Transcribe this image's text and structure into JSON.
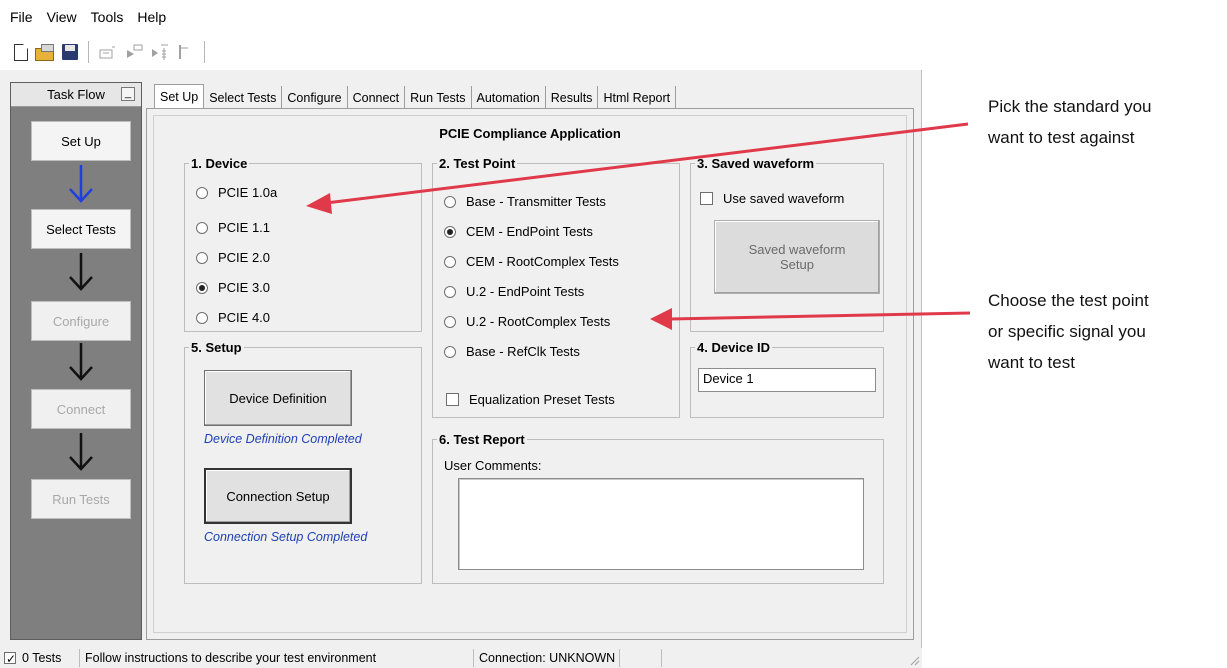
{
  "menu": [
    "File",
    "View",
    "Tools",
    "Help"
  ],
  "toolbar": {
    "icons": [
      "new-file-icon",
      "open-folder-icon",
      "save-icon",
      "run-icon",
      "step-icon",
      "sequence-icon",
      "stop-icon"
    ]
  },
  "taskflow": {
    "title": "Task Flow",
    "minimize": "_",
    "steps": [
      {
        "label": "Set Up",
        "enabled": true
      },
      {
        "label": "Select Tests",
        "enabled": true
      },
      {
        "label": "Configure",
        "enabled": false
      },
      {
        "label": "Connect",
        "enabled": false
      },
      {
        "label": "Run Tests",
        "enabled": false
      }
    ],
    "arrow_colors": [
      "#1f3fe0",
      "#111111",
      "#111111",
      "#111111"
    ]
  },
  "tabs": [
    "Set Up",
    "Select Tests",
    "Configure",
    "Connect",
    "Run Tests",
    "Automation",
    "Results",
    "Html Report"
  ],
  "active_tab": "Set Up",
  "app_title": "PCIE Compliance Application",
  "device": {
    "legend": "1. Device",
    "options": [
      "PCIE 1.0a",
      "PCIE 1.1",
      "PCIE 2.0",
      "PCIE 3.0",
      "PCIE 4.0"
    ],
    "selected": "PCIE 3.0"
  },
  "test_point": {
    "legend": "2. Test Point",
    "options": [
      "Base - Transmitter Tests",
      "CEM - EndPoint Tests",
      "CEM - RootComplex Tests",
      "U.2 - EndPoint Tests",
      "U.2 - RootComplex Tests",
      "Base - RefClk Tests"
    ],
    "selected": "CEM - EndPoint Tests",
    "equalization_label": "Equalization Preset Tests",
    "equalization_checked": false
  },
  "saved_waveform": {
    "legend": "3. Saved waveform",
    "checkbox_label": "Use saved waveform",
    "checked": false,
    "button_label": "Saved waveform Setup"
  },
  "device_id": {
    "legend": "4. Device ID",
    "value": "Device 1"
  },
  "setup": {
    "legend": "5. Setup",
    "device_definition_button": "Device Definition",
    "device_definition_status": "Device Definition Completed",
    "connection_setup_button": "Connection Setup",
    "connection_setup_status": "Connection Setup Completed"
  },
  "test_report": {
    "legend": "6. Test Report",
    "comments_label": "User Comments:",
    "comments_value": ""
  },
  "statusbar": {
    "tests": "0 Tests",
    "tests_checked": true,
    "message": "Follow instructions to describe your test environment",
    "connection": "Connection: UNKNOWN",
    "extra": ""
  },
  "callouts": {
    "standard": [
      "Pick the standard you",
      "want to test against"
    ],
    "test_point": [
      "Choose the test point",
      "or specific signal you",
      "want to test"
    ]
  },
  "colors": {
    "accent_blue": "#1f3fe0",
    "status_blue": "#1f3fb4",
    "callout_arrow": "#e03a4a"
  }
}
